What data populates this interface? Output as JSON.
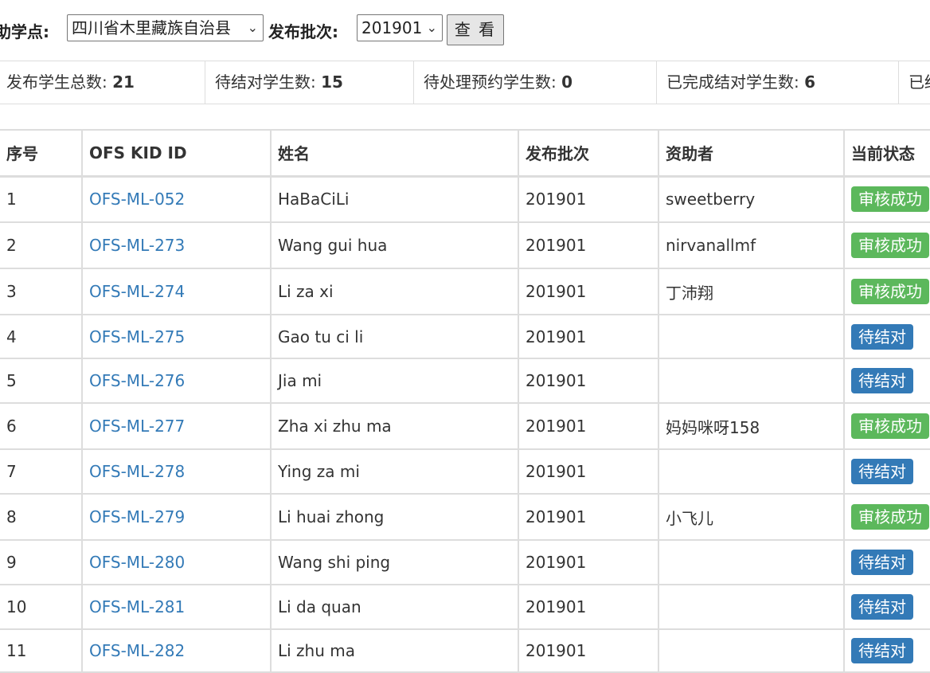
{
  "filters": {
    "site_label": "助学点:",
    "site_value": "四川省木里藏族自治县",
    "batch_label": "发布批次:",
    "batch_value": "201901",
    "view_button": "查 看"
  },
  "stats": [
    {
      "label": "发布学生总数: ",
      "value": "21"
    },
    {
      "label": "待结对学生数: ",
      "value": "15"
    },
    {
      "label": "待处理预约学生数: ",
      "value": "0"
    },
    {
      "label": "已完成结对学生数: ",
      "value": "6"
    },
    {
      "label": "已结",
      "value": ""
    }
  ],
  "table": {
    "headers": [
      "序号",
      "OFS KID ID",
      "姓名",
      "发布批次",
      "资助者",
      "当前状态"
    ],
    "status_colors": {
      "ok": "#5cb85c",
      "wait": "#337ab7",
      "link": "#337ab7"
    },
    "rows": [
      {
        "no": "1",
        "kid": "OFS-ML-052",
        "name": "HaBaCiLi",
        "batch": "201901",
        "sponsor": "sweetberry",
        "status": "审核成功",
        "status_type": "ok"
      },
      {
        "no": "2",
        "kid": "OFS-ML-273",
        "name": "Wang gui hua",
        "batch": "201901",
        "sponsor": "nirvanallmf",
        "status": "审核成功",
        "status_type": "ok"
      },
      {
        "no": "3",
        "kid": "OFS-ML-274",
        "name": "Li za xi",
        "batch": "201901",
        "sponsor": "丁沛翔",
        "status": "审核成功",
        "status_type": "ok"
      },
      {
        "no": "4",
        "kid": "OFS-ML-275",
        "name": "Gao tu ci li",
        "batch": "201901",
        "sponsor": "",
        "status": "待结对",
        "status_type": "wait"
      },
      {
        "no": "5",
        "kid": "OFS-ML-276",
        "name": "Jia mi",
        "batch": "201901",
        "sponsor": "",
        "status": "待结对",
        "status_type": "wait"
      },
      {
        "no": "6",
        "kid": "OFS-ML-277",
        "name": "Zha xi zhu ma",
        "batch": "201901",
        "sponsor": "妈妈咪呀158",
        "status": "审核成功",
        "status_type": "ok"
      },
      {
        "no": "7",
        "kid": "OFS-ML-278",
        "name": "Ying za mi",
        "batch": "201901",
        "sponsor": "",
        "status": "待结对",
        "status_type": "wait"
      },
      {
        "no": "8",
        "kid": "OFS-ML-279",
        "name": "Li huai zhong",
        "batch": "201901",
        "sponsor": "小飞儿",
        "status": "审核成功",
        "status_type": "ok"
      },
      {
        "no": "9",
        "kid": "OFS-ML-280",
        "name": "Wang shi ping",
        "batch": "201901",
        "sponsor": "",
        "status": "待结对",
        "status_type": "wait"
      },
      {
        "no": "10",
        "kid": "OFS-ML-281",
        "name": "Li da quan",
        "batch": "201901",
        "sponsor": "",
        "status": "待结对",
        "status_type": "wait"
      },
      {
        "no": "11",
        "kid": "OFS-ML-282",
        "name": "Li zhu ma",
        "batch": "201901",
        "sponsor": "",
        "status": "待结对",
        "status_type": "wait"
      }
    ]
  }
}
